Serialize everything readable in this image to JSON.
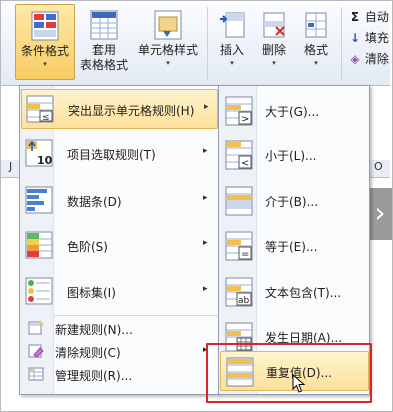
{
  "ribbon": {
    "conditional_format": {
      "label": "条件格式",
      "arrow": "▾"
    },
    "format_as_table": {
      "line1": "套用",
      "line2": "表格格式",
      "arrow": "▾"
    },
    "cell_styles": {
      "label": "单元格样式",
      "arrow": "▾"
    },
    "insert": {
      "label": "插入",
      "arrow": "▾"
    },
    "delete": {
      "label": "删除",
      "arrow": "▾"
    },
    "format": {
      "label": "格式",
      "arrow": "▾"
    },
    "autosum": {
      "glyph": "Σ",
      "label": "自动"
    },
    "fill": {
      "glyph": "↓",
      "label": "填充"
    },
    "clear": {
      "glyph": "◈",
      "label": "清除"
    }
  },
  "sheet": {
    "col_j": "J",
    "col_o": "O",
    "nav_arrow": "›"
  },
  "main_menu": {
    "items": [
      {
        "label": "突出显示单元格规则(H)",
        "icon": "highlight-rules-icon",
        "submenu": "▸"
      },
      {
        "label": "项目选取规则(T)",
        "icon": "top-bottom-rules-icon",
        "submenu": "▸"
      },
      {
        "label": "数据条(D)",
        "icon": "data-bars-icon",
        "submenu": "▸"
      },
      {
        "label": "色阶(S)",
        "icon": "color-scales-icon",
        "submenu": "▸"
      },
      {
        "label": "图标集(I)",
        "icon": "icon-sets-icon",
        "submenu": "▸"
      }
    ],
    "small_items": [
      {
        "label": "新建规则(N)...",
        "icon": "new-rule-icon"
      },
      {
        "label": "清除规则(C)",
        "icon": "clear-rules-icon",
        "submenu": "▸"
      },
      {
        "label": "管理规则(R)...",
        "icon": "manage-rules-icon"
      }
    ],
    "top10_text": "10"
  },
  "sub_menu": {
    "items": [
      {
        "label": "大于(G)...",
        "icon": "greater-than-icon",
        "sym": ">"
      },
      {
        "label": "小于(L)...",
        "icon": "less-than-icon",
        "sym": "<"
      },
      {
        "label": "介于(B)...",
        "icon": "between-icon",
        "sym": ""
      },
      {
        "label": "等于(E)...",
        "icon": "equal-to-icon",
        "sym": "="
      },
      {
        "label": "文本包含(T)...",
        "icon": "text-contains-icon",
        "sym": "ab"
      },
      {
        "label": "发生日期(A)...",
        "icon": "date-occurring-icon",
        "sym": ""
      },
      {
        "label": "重复值(D)...",
        "icon": "duplicate-values-icon",
        "sym": ""
      }
    ]
  },
  "colors": {
    "highlight": "#fde09a",
    "red_box": "#d9262c",
    "ribbon": "#e3eaf4"
  }
}
